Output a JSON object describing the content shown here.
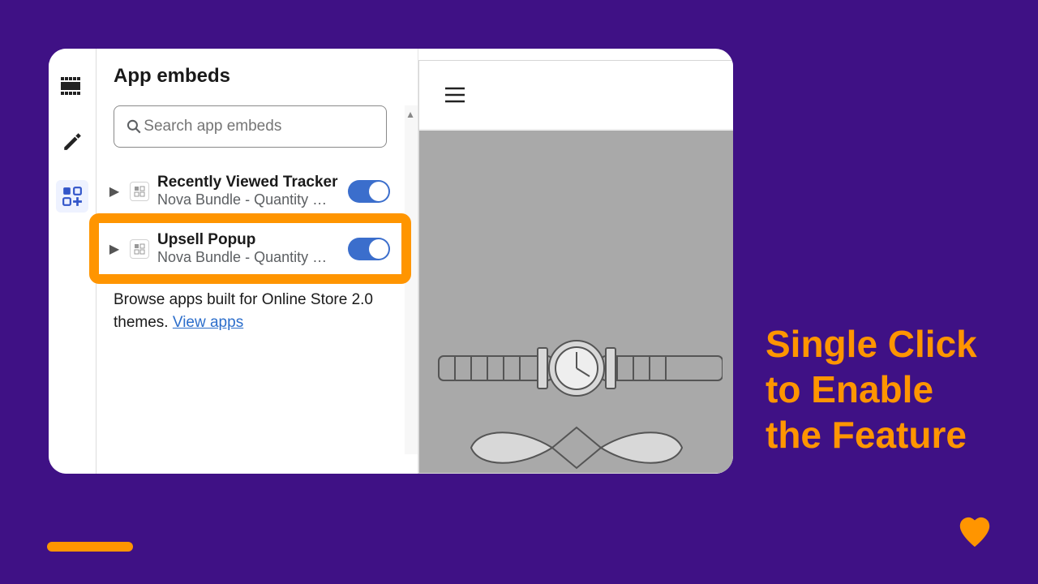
{
  "panel": {
    "title": "App embeds",
    "search_placeholder": "Search app embeds"
  },
  "embeds": [
    {
      "title": "Recently Viewed Tracker",
      "subtitle": "Nova Bundle - Quantity …",
      "enabled": true
    },
    {
      "title": "Upsell Popup",
      "subtitle": "Nova Bundle - Quantity …",
      "enabled": true
    }
  ],
  "browse": {
    "text": "Browse apps built for Online Store 2.0 themes. ",
    "link_label": "View apps"
  },
  "headline": {
    "l1": "Single Click",
    "l2": "to Enable",
    "l3": "the Feature"
  }
}
